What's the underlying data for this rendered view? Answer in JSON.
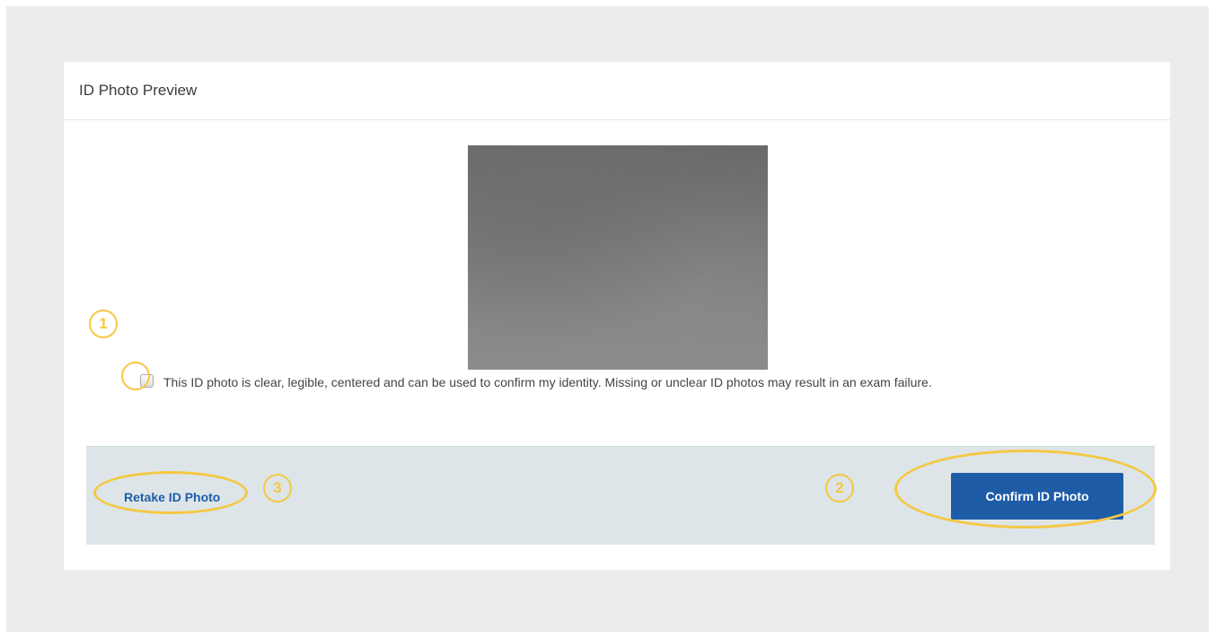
{
  "panel": {
    "title": "ID Photo Preview"
  },
  "acknowledgement": {
    "label": "This ID photo is clear, legible, centered and can be used to confirm my identity. Missing or unclear ID photos may result in an exam failure.",
    "checked": false
  },
  "footer": {
    "retake_label": "Retake ID Photo",
    "confirm_label": "Confirm ID Photo"
  },
  "annotations": {
    "one": "1",
    "two": "2",
    "three": "3",
    "color": "#f5c842"
  },
  "colors": {
    "primary": "#1e5ca8",
    "link": "#1f5da9",
    "footer_bg": "#dee5e9",
    "page_bg": "#ececec"
  }
}
